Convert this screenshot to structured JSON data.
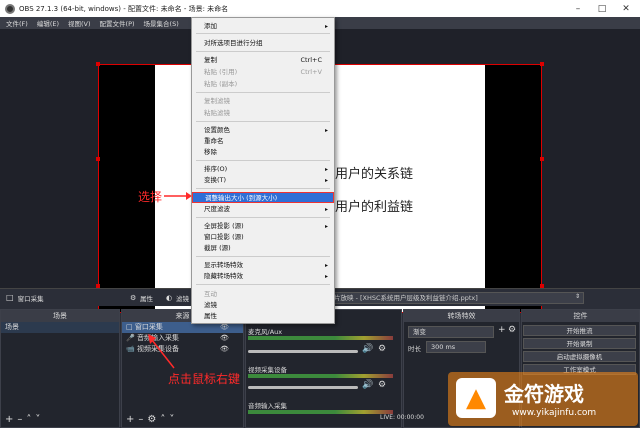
{
  "window": {
    "title": "OBS 27.1.3 (64-bit, windows) - 配置文件: 未命名 - 场景: 未命名"
  },
  "menubar": [
    "文件(F)",
    "编辑(E)",
    "视图(V)",
    "配置文件(P)",
    "场景集合(S)"
  ],
  "canvas": {
    "line1": "用户的关系链",
    "line2": "用户的利益链"
  },
  "context_menu": {
    "items": [
      {
        "label": "添加",
        "submenu": true
      },
      {
        "label": "对所选项目进行分组"
      },
      {
        "label": "复制",
        "shortcut": "Ctrl+C"
      },
      {
        "label": "粘贴 (引用)",
        "shortcut": "Ctrl+V",
        "disabled": true
      },
      {
        "label": "粘贴 (副本)",
        "disabled": true
      },
      {
        "label": "复制滤镜",
        "disabled": true
      },
      {
        "label": "粘贴滤镜",
        "disabled": true
      },
      {
        "label": "设置颜色",
        "submenu": true
      },
      {
        "label": "重命名"
      },
      {
        "label": "移除"
      },
      {
        "label": "排序(O)",
        "submenu": true
      },
      {
        "label": "变换(T)",
        "submenu": true
      },
      {
        "label": "调整输出大小 (到源大小)",
        "highlighted": true
      },
      {
        "label": "尺度滤波",
        "submenu": true
      },
      {
        "label": "全屏投影 (源)",
        "submenu": true
      },
      {
        "label": "窗口投影 (源)"
      },
      {
        "label": "截屏 (源)"
      },
      {
        "label": "显示转场特效",
        "submenu": true
      },
      {
        "label": "隐藏转场特效",
        "submenu": true
      },
      {
        "label": "互动",
        "disabled": true
      },
      {
        "label": "滤镜"
      },
      {
        "label": "属性"
      }
    ]
  },
  "source_toolbar": {
    "current_source": "窗口采集",
    "properties_label": "属性",
    "filters_label": "滤镜",
    "window_value": "片放映 - [XHSC系统用户层级及利益链介绍.pptx]"
  },
  "annotations": {
    "select": "选择",
    "right_click": "点击鼠标右键"
  },
  "scenes": {
    "header": "场景",
    "items": [
      "场景"
    ]
  },
  "sources": {
    "header": "来源",
    "items": [
      "窗口采集",
      "音频输入采集",
      "视频采集设备"
    ]
  },
  "mixer": {
    "rows": [
      {
        "name": "麦克风/Aux"
      },
      {
        "name": "视频采集设备"
      },
      {
        "name": "音频输入采集"
      }
    ]
  },
  "transitions": {
    "header": "转场特效",
    "type": "渐变",
    "duration_label": "时长",
    "duration_value": "300 ms"
  },
  "controls": {
    "header": "控件",
    "buttons": [
      "开始推流",
      "开始录制",
      "启动虚拟摄像机",
      "工作室模式"
    ]
  },
  "status": {
    "live": "LIVE: 00:00:00"
  },
  "watermark": {
    "brand": "金符游戏",
    "url": "www.yikajinfu.com"
  }
}
